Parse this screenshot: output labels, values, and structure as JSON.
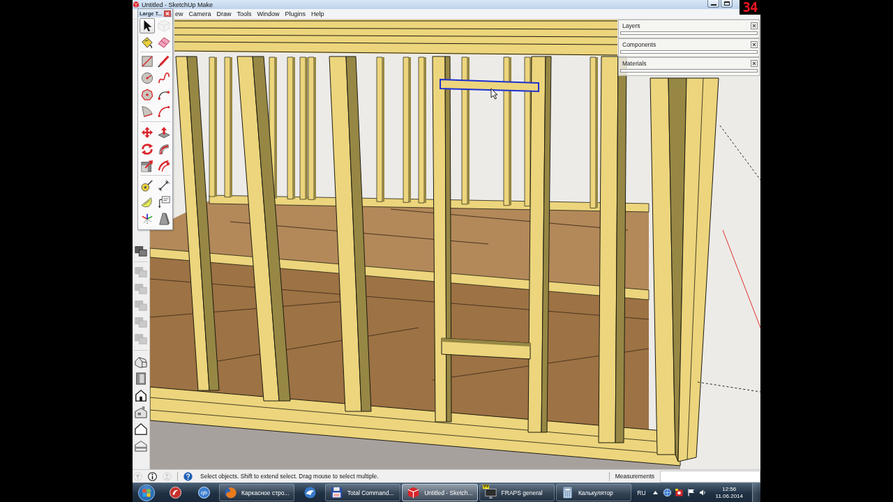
{
  "window": {
    "title": "Untitled - SketchUp Make"
  },
  "fps_counter": "34",
  "menu": [
    "ew",
    "Camera",
    "Draw",
    "Tools",
    "Window",
    "Plugins",
    "Help"
  ],
  "palette": {
    "title": "Large T...",
    "groups": [
      {
        "tools": [
          {
            "kind": "select",
            "selected": true,
            "disabled": false
          },
          {
            "kind": "component",
            "selected": false,
            "disabled": true
          },
          {
            "kind": "paint",
            "selected": false,
            "disabled": false
          },
          {
            "kind": "eraser",
            "selected": false,
            "disabled": false
          }
        ]
      },
      {
        "tools": [
          {
            "kind": "rectangle",
            "selected": false,
            "disabled": false
          },
          {
            "kind": "line",
            "selected": false,
            "disabled": false
          },
          {
            "kind": "circle",
            "selected": false,
            "disabled": false
          },
          {
            "kind": "freehand",
            "selected": false,
            "disabled": false
          },
          {
            "kind": "polygon",
            "selected": false,
            "disabled": false
          },
          {
            "kind": "arc",
            "selected": false,
            "disabled": false
          },
          {
            "kind": "pie",
            "selected": false,
            "disabled": false
          },
          {
            "kind": "arc3",
            "selected": false,
            "disabled": false
          }
        ]
      },
      {
        "tools": [
          {
            "kind": "move",
            "selected": false,
            "disabled": false
          },
          {
            "kind": "pushpull",
            "selected": false,
            "disabled": false
          },
          {
            "kind": "rotate",
            "selected": false,
            "disabled": false
          },
          {
            "kind": "followme",
            "selected": false,
            "disabled": false
          },
          {
            "kind": "scale",
            "selected": false,
            "disabled": false
          },
          {
            "kind": "offset",
            "selected": false,
            "disabled": false
          }
        ]
      },
      {
        "tools": [
          {
            "kind": "tape",
            "selected": false,
            "disabled": false
          },
          {
            "kind": "dimension",
            "selected": false,
            "disabled": false
          },
          {
            "kind": "protractor",
            "selected": false,
            "disabled": false
          },
          {
            "kind": "text",
            "selected": false,
            "disabled": false
          },
          {
            "kind": "axes",
            "selected": false,
            "disabled": false
          },
          {
            "kind": "text3d",
            "selected": false,
            "disabled": false
          }
        ]
      }
    ]
  },
  "dock": {
    "groups": [
      {
        "tools": [
          {
            "kind": "stack",
            "disabled": false
          }
        ]
      },
      {
        "tools": [
          {
            "kind": "stack",
            "disabled": true
          },
          {
            "kind": "stack",
            "disabled": true
          },
          {
            "kind": "stack",
            "disabled": true
          },
          {
            "kind": "stack",
            "disabled": true
          },
          {
            "kind": "stack",
            "disabled": true
          }
        ]
      },
      {
        "tools": [
          {
            "kind": "iso",
            "disabled": false
          },
          {
            "kind": "top",
            "disabled": false
          },
          {
            "kind": "front",
            "disabled": false
          },
          {
            "kind": "right",
            "disabled": false
          },
          {
            "kind": "back",
            "disabled": false
          },
          {
            "kind": "left",
            "disabled": false
          }
        ]
      }
    ]
  },
  "viewport": {
    "selected_beam": {
      "selected": true
    }
  },
  "trays": [
    {
      "title": "Layers"
    },
    {
      "title": "Components"
    },
    {
      "title": "Materials"
    }
  ],
  "status_bar": {
    "icons": [
      {
        "kind": "location",
        "disabled": true
      },
      {
        "kind": "info",
        "disabled": false
      },
      {
        "kind": "person",
        "disabled": true
      },
      {
        "kind": "help",
        "disabled": false
      }
    ],
    "message": "Select objects. Shift to extend select. Drag mouse to select multiple.",
    "measurements_label": "Measurements"
  },
  "taskbar": {
    "items": [
      {
        "kind": "swirl",
        "selected": false
      },
      {
        "kind": "qb",
        "logo_text": "qb",
        "selected": false
      },
      {
        "kind": "browser",
        "label": "Каркасное стро...",
        "selected": false
      },
      {
        "kind": "mail",
        "selected": false
      },
      {
        "kind": "files",
        "label": "Total Command...",
        "selected": false
      },
      {
        "kind": "sketch",
        "label": "Untitled - Sketch...",
        "selected": true
      },
      {
        "kind": "fraps",
        "label": "FRAPS general",
        "badge": "99",
        "selected": false
      },
      {
        "kind": "calculator",
        "label": "Калькулятор",
        "selected": false
      }
    ],
    "language": "RU",
    "clock": {
      "time": "12:56",
      "date": "11.06.2014"
    }
  }
}
